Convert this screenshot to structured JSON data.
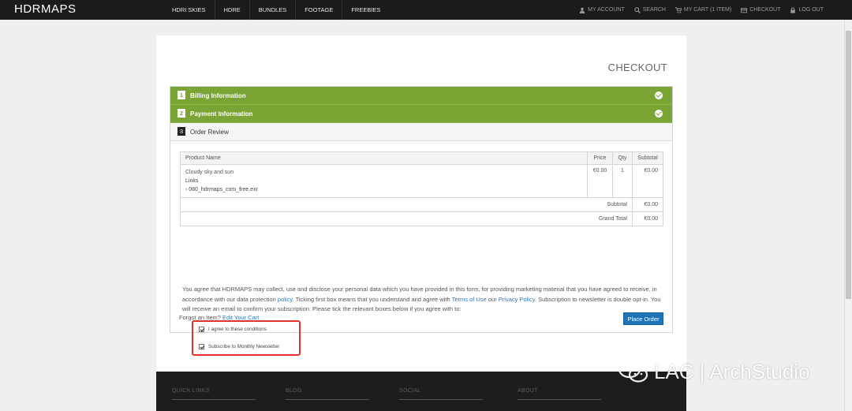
{
  "header": {
    "logo": "HDRMAPS",
    "main_nav": [
      "HDRI SKIES",
      "HDRE",
      "BUNDLES",
      "FOOTAGE",
      "FREEBIES"
    ],
    "account": "MY ACCOUNT",
    "search": "SEARCH",
    "cart": "MY CART (1 ITEM)",
    "checkout": "CHECKOUT",
    "logout": "LOG OUT"
  },
  "page": {
    "title": "CHECKOUT",
    "steps": [
      {
        "num": "1",
        "label": "Billing Information"
      },
      {
        "num": "2",
        "label": "Payment Information"
      },
      {
        "num": "3",
        "label": "Order Review"
      }
    ]
  },
  "table": {
    "headers": {
      "product": "Product Name",
      "price": "Price",
      "qty": "Qty",
      "subtotal": "Subtotal"
    },
    "item": {
      "name": "Cloudy sky and sun",
      "links_label": "Links",
      "file": "› 080_hdrmaps_com_free.exr",
      "price": "€0.00",
      "qty": "1",
      "subtotal": "€0.00"
    },
    "subtotal_label": "Subtotal",
    "subtotal_value": "€0.00",
    "grand_total_label": "Grand Total",
    "grand_total_value": "€0.00"
  },
  "agreement": {
    "part1": "You agree that HDRMAPS may collect, use and disclose your personal data which you have provided in this form, for providing marketing material that you have agreed to receive, in accordance with our data protection ",
    "policy_link": "policy",
    "part2": ". Ticking first box means that you understand and agree with ",
    "terms_link": "Terms of Use",
    "part3": " our ",
    "privacy_link": "Privacy Policy",
    "part4": ". Subscription to newsletter is double opt-in. You will receive an email to confirm your subscription. Please tick the relevant boxes below if you agree with to:"
  },
  "consent": {
    "conditions": "I agree to these conditions",
    "newsletter": "Subscribe to Monthly Newsletter"
  },
  "actions": {
    "forgot_text": "Forgot an Item? ",
    "edit_cart": "Edit Your Cart",
    "place_order": "Place Order"
  },
  "footer": {
    "quick_links": "QUICK LINKS",
    "blog": "BLOG",
    "social": "SOCIAL",
    "about": "ABOUT"
  },
  "watermark": "LAC | ArchStudio"
}
